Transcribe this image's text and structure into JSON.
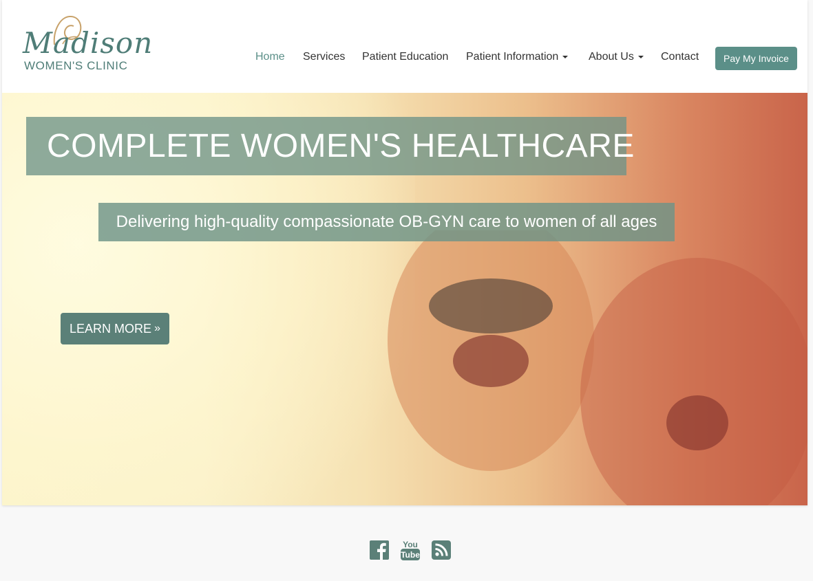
{
  "logo": {
    "script": "Madison",
    "subtitle": "WOMEN'S CLINIC"
  },
  "nav": {
    "items": [
      {
        "label": "Home",
        "active": true,
        "dropdown": false
      },
      {
        "label": "Services",
        "active": false,
        "dropdown": false
      },
      {
        "label": "Patient Education",
        "active": false,
        "dropdown": false
      },
      {
        "label": "Patient Information",
        "active": false,
        "dropdown": true
      },
      {
        "label": "About Us",
        "active": false,
        "dropdown": true
      },
      {
        "label": "Contact",
        "active": false,
        "dropdown": false
      }
    ],
    "pay_button": "Pay My Invoice"
  },
  "hero": {
    "title": "COMPLETE WOMEN'S HEALTHCARE",
    "subtitle": "Delivering high-quality compassionate OB-GYN care to women of all ages",
    "cta": "LEARN MORE",
    "cta_icon": "double-chevron-right-icon"
  },
  "social": {
    "icons": [
      "facebook-icon",
      "youtube-icon",
      "rss-icon"
    ],
    "youtube_top": "You",
    "youtube_bottom": "Tube"
  },
  "colors": {
    "accent": "#5b8f88",
    "hero_box": "#6e9488",
    "page_bg": "#f8f8f8"
  }
}
